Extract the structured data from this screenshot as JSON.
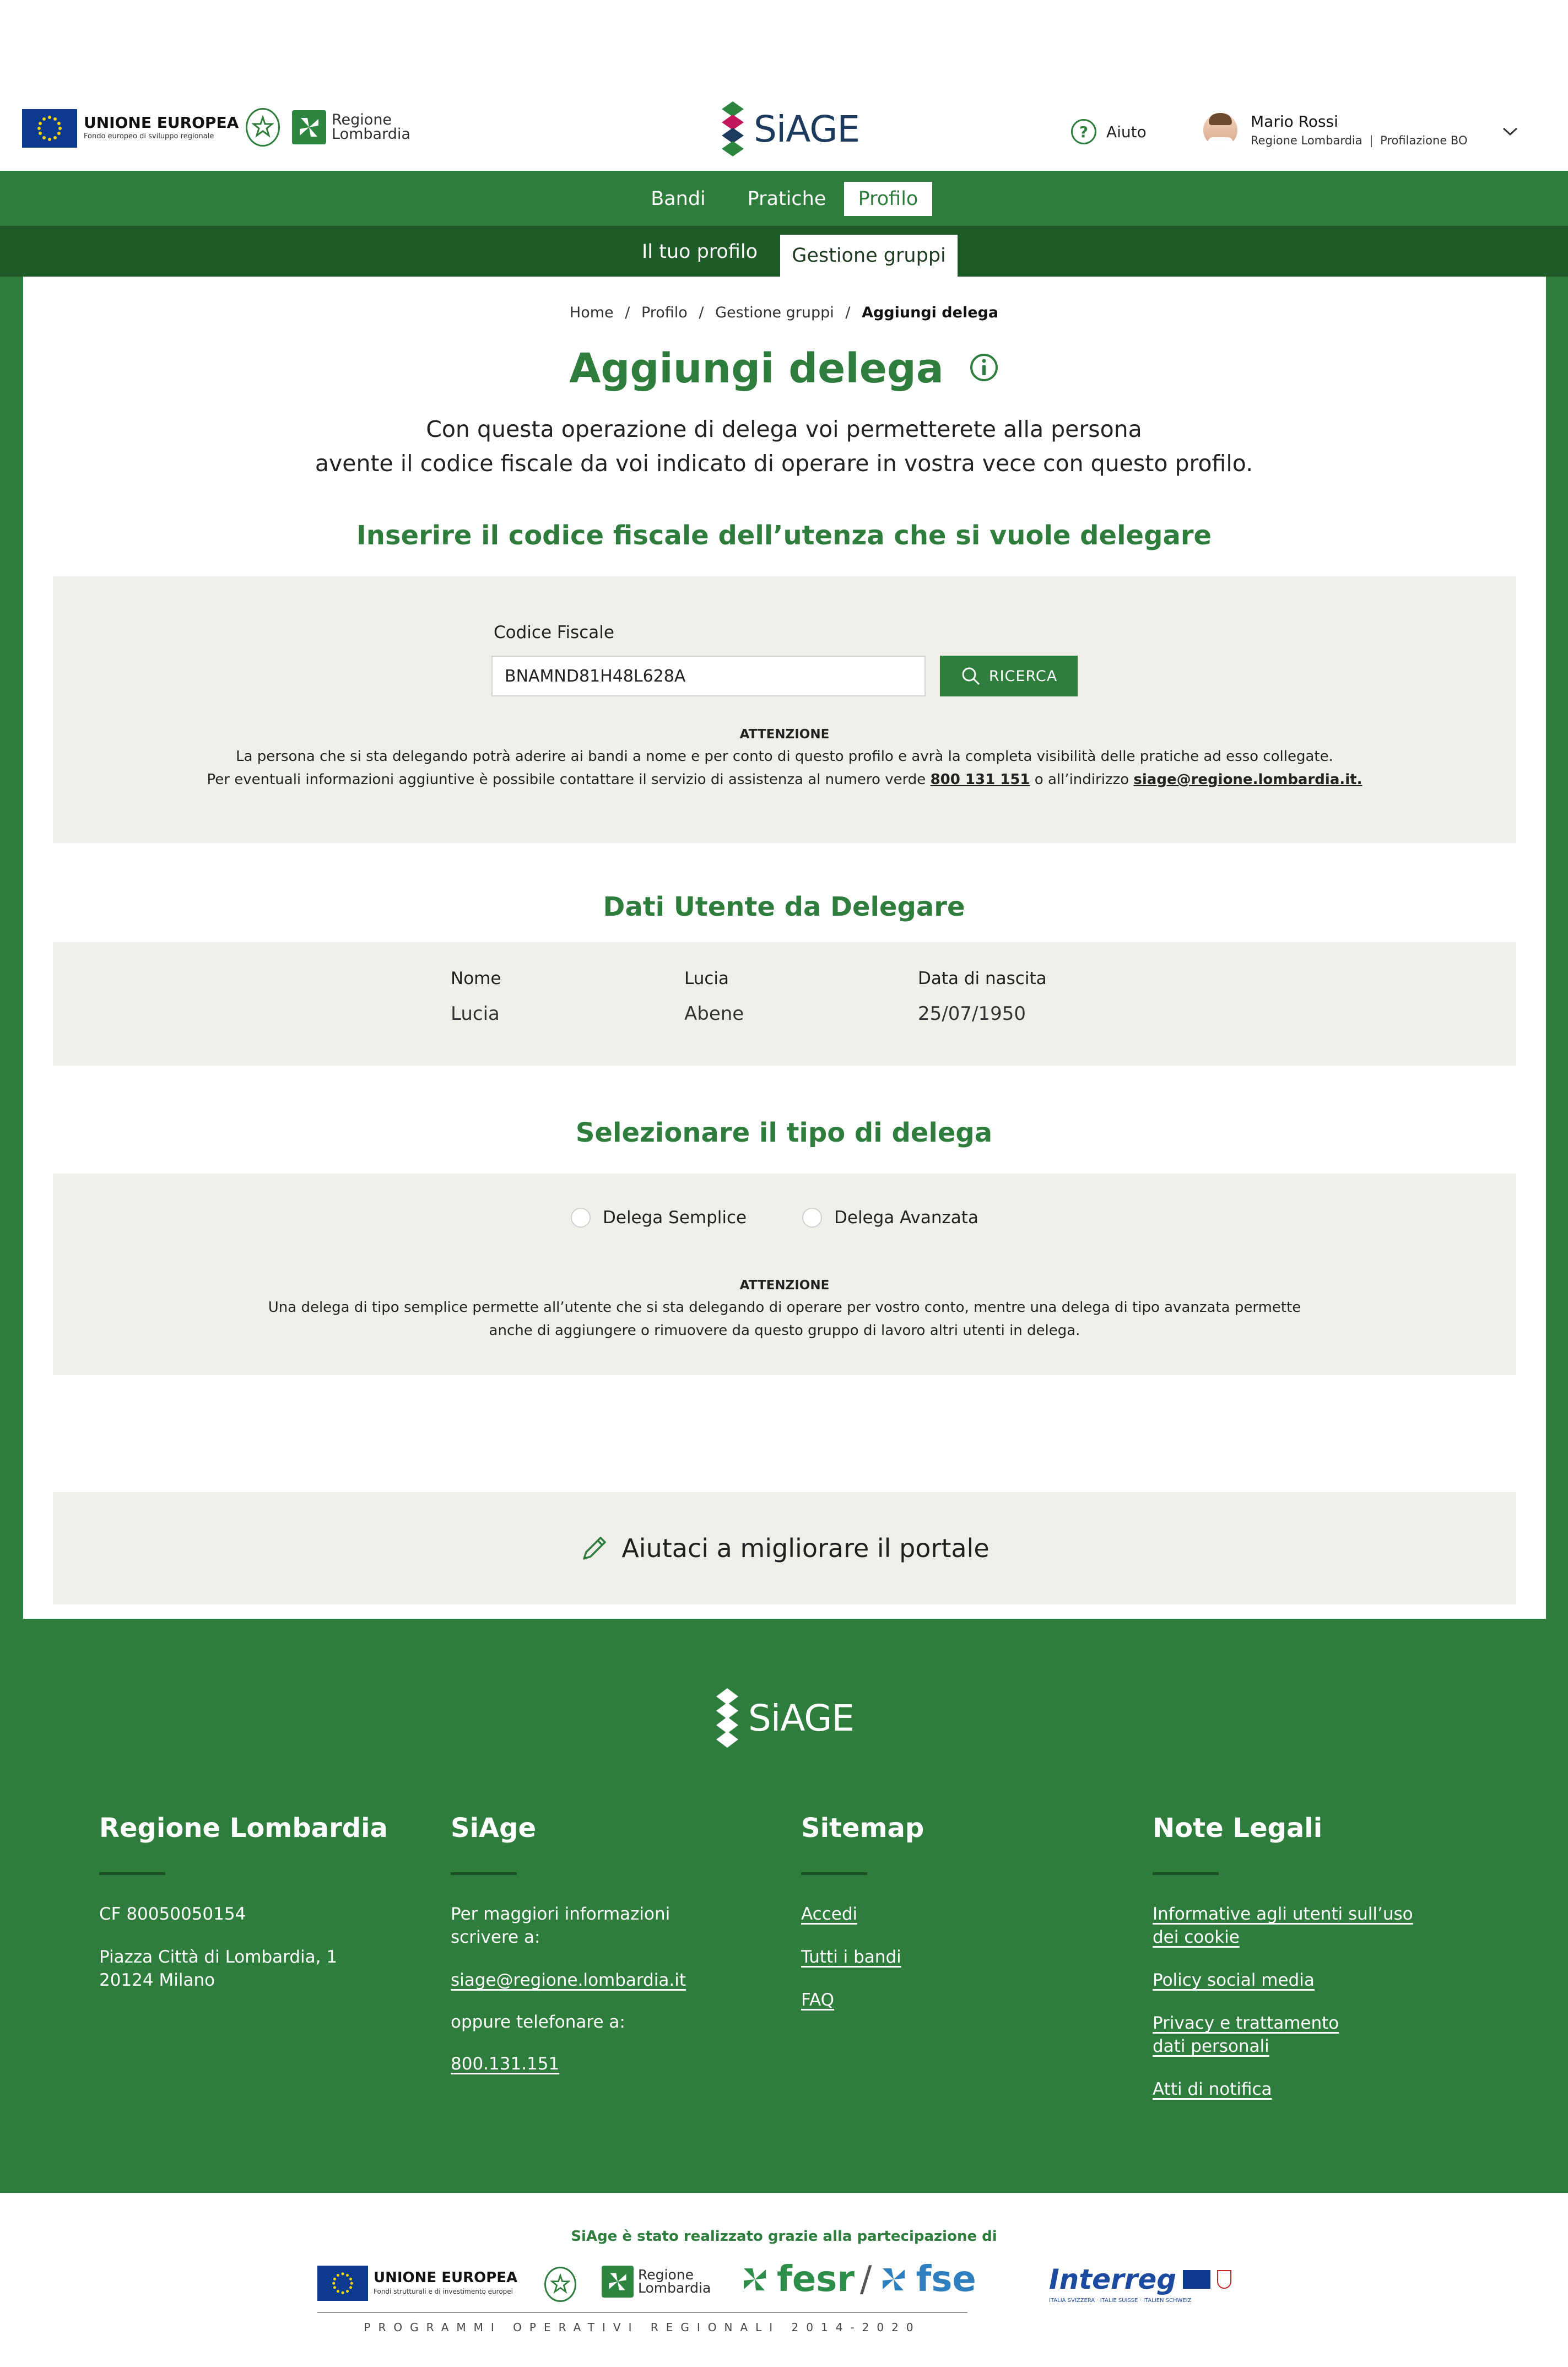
{
  "header": {
    "eu_title": "UNIONE EUROPEA",
    "eu_subtitle": "Fondo europeo di sviluppo regionale",
    "region_line1": "Regione",
    "region_line2": "Lombardia",
    "brand": "SiAGE",
    "help_label": "Aiuto",
    "user_name": "Mario Rossi",
    "user_org": "Regione Lombardia",
    "user_profile": "Profilazione BO"
  },
  "nav": {
    "main": [
      "Bandi",
      "Pratiche",
      "Profilo"
    ],
    "active_main": "Profilo",
    "sub": [
      "Il tuo profilo",
      "Gestione gruppi"
    ],
    "active_sub": "Gestione gruppi"
  },
  "breadcrumb": {
    "home": "Home",
    "profilo": "Profilo",
    "gestione": "Gestione gruppi",
    "current": "Aggiungi delega"
  },
  "page": {
    "title": "Aggiungi delega",
    "intro_line1": "Con questa operazione di delega voi permetterete alla persona",
    "intro_line2": "avente il codice fiscale da voi indicato di operare in vostra vece con questo profilo."
  },
  "search_section": {
    "title": "Inserire il codice fiscale dell’utenza che si vuole delegare",
    "field_label": "Codice Fiscale",
    "field_value": "BNAMND81H48L628A",
    "button_label": "RICERCA",
    "attention_title": "ATTENZIONE",
    "attention_line1": "La persona che si sta delegando potrà aderire ai bandi a nome e per conto di questo profilo e avrà la completa visibilità delle pratiche ad esso collegate.",
    "attention_line2_pre": "Per eventuali informazioni aggiuntive è possibile contattare il servizio di assistenza al numero verde",
    "phone": "800 131 151",
    "attention_line2_mid": "o all’indirizzo",
    "email": "siage@regione.lombardia.it."
  },
  "user_section": {
    "title": "Dati Utente da Delegare",
    "col1_label": "Nome",
    "col1_value": "Lucia",
    "col2_label": "Lucia",
    "col2_value": "Abene",
    "col3_label": "Data di nascita",
    "col3_value": "25/07/1950"
  },
  "type_section": {
    "title": "Selezionare il tipo di delega",
    "option1": "Delega Semplice",
    "option2": "Delega Avanzata",
    "attention_title": "ATTENZIONE",
    "attention_line1": "Una delega di tipo semplice permette all’utente che si sta  delegando di operare per vostro conto, mentre una delega di tipo avanzata permette",
    "attention_line2": "anche di aggiungere o rimuovere da questo gruppo di lavoro altri utenti in delega."
  },
  "feedback": {
    "label": "Aiutaci a migliorare il portale"
  },
  "footer": {
    "brand": "SiAGE",
    "col1": {
      "title": "Regione Lombardia",
      "cf": "CF 80050050154",
      "address1": "Piazza Città di Lombardia, 1",
      "address2": "20124 Milano"
    },
    "col2": {
      "title": "SiAge",
      "text1a": "Per maggiori informazioni",
      "text1b": "scrivere a:",
      "email": "siage@regione.lombardia.it",
      "text2": "oppure telefonare a:",
      "phone": "800.131.151"
    },
    "col3": {
      "title": "Sitemap",
      "links": [
        "Accedi",
        "Tutti i bandi",
        "FAQ"
      ]
    },
    "col4": {
      "title": "Note Legali",
      "link1a": "Informative agli utenti sull’uso",
      "link1b": "dei cookie",
      "link2": "Policy social media",
      "link3a": "Privacy e trattamento",
      "link3b": "dati personali",
      "link4": "Atti di notifica"
    }
  },
  "partners": {
    "title": "SiAge è stato realizzato grazie alla partecipazione di",
    "eu_title": "UNIONE EUROPEA",
    "eu_subtitle": "Fondi strutturali e di investimento europei",
    "region_line1": "Regione",
    "region_line2": "Lombardia",
    "fesr": "fesr",
    "fse": "fse",
    "interreg": "Interreg",
    "interreg_sub": "ITALIA SVIZZERA · ITALIE SUISSE · ITALIEN SCHWEIZ",
    "programmes": "PROGRAMMI OPERATIVI REGIONALI 2014-2020"
  },
  "colors": {
    "primary_green": "#2e7d3c",
    "dark_green": "#1f5a29",
    "panel_gray": "#efeee9"
  }
}
